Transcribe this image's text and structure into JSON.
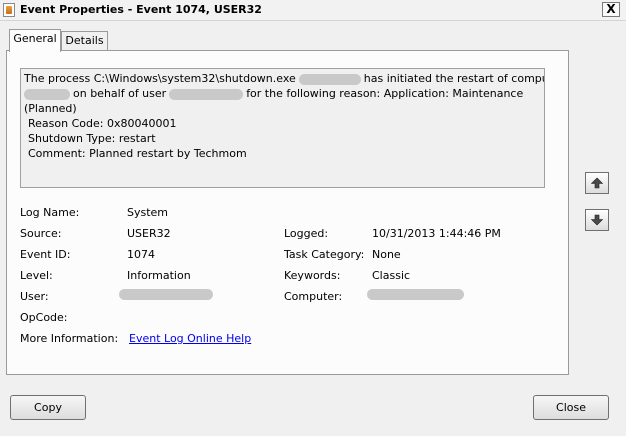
{
  "window": {
    "title": "Event Properties - Event 1074, USER32",
    "close_glyph": "X"
  },
  "tabs": [
    {
      "label": "General",
      "active": true
    },
    {
      "label": "Details",
      "active": false
    }
  ],
  "message": {
    "line1_a": "The process C:\\Windows\\system32\\shutdown.exe",
    "line1_b": "has initiated the restart of computer",
    "line2_a": "on behalf of user",
    "line2_b": "for the following reason: Application: Maintenance",
    "line3": "(Planned)",
    "line4": "Reason Code: 0x80040001",
    "line5": "Shutdown Type: restart",
    "line6": "Comment: Planned restart by Techmom"
  },
  "fields": {
    "log_name_label": "Log Name:",
    "log_name_value": "System",
    "source_label": "Source:",
    "source_value": "USER32",
    "logged_label": "Logged:",
    "logged_value": "10/31/2013 1:44:46 PM",
    "event_id_label": "Event ID:",
    "event_id_value": "1074",
    "task_category_label": "Task Category:",
    "task_category_value": "None",
    "level_label": "Level:",
    "level_value": "Information",
    "keywords_label": "Keywords:",
    "keywords_value": "Classic",
    "user_label": "User:",
    "computer_label": "Computer:",
    "opcode_label": "OpCode:",
    "more_info_label": "More Information:",
    "more_info_link": "Event Log Online Help"
  },
  "icons": {
    "app": "event-viewer-icon",
    "prev": "up-arrow-icon",
    "next": "down-arrow-icon"
  },
  "buttons": {
    "copy": "Copy",
    "close": "Close"
  }
}
